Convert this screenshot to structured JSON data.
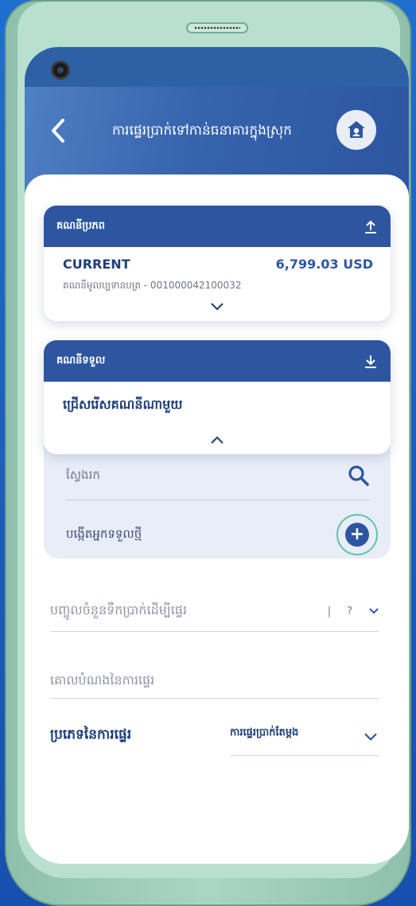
{
  "header": {
    "title": "ការផ្ទេរប្រាក់ទៅកាន់ធនាគារក្នុងស្រុក",
    "back_icon": "chevron-left-icon",
    "home_icon": "home-icon"
  },
  "source_account": {
    "heading": "គណនីប្រភព",
    "heading_icon": "upload-icon",
    "name": "CURRENT",
    "balance": "6,799.03 USD",
    "number": "គណនីមូលប្បទានបត្រ - 001000042100032"
  },
  "destination_account": {
    "heading": "គណនីទទួល",
    "heading_icon": "download-icon",
    "placeholder": "ជ្រើសរើសគណនីណាមួយ"
  },
  "recipient_panel": {
    "search_label": "ស្វែងរក",
    "new_recipient_label": "បង្កើតអ្នកទទួលថ្មី",
    "add_symbol": "+"
  },
  "form": {
    "amount_label": "បញ្ចូលចំនួនទឹកប្រាក់ដើម្បីផ្ទេរ",
    "amount_separator": "|",
    "currency_value": "?",
    "purpose_label": "គោលបំណងនៃការផ្ទេរ",
    "transfer_type_label": "ប្រភេទនៃការផ្ទេរ",
    "transfer_type_value": "ការផ្ទេរប្រាក់តែម្តង"
  },
  "colors": {
    "primary": "#2e56a0",
    "accent_ring": "#5fc4a8",
    "phone_body": "#a9d6c2",
    "background": "#1e6fd0"
  }
}
